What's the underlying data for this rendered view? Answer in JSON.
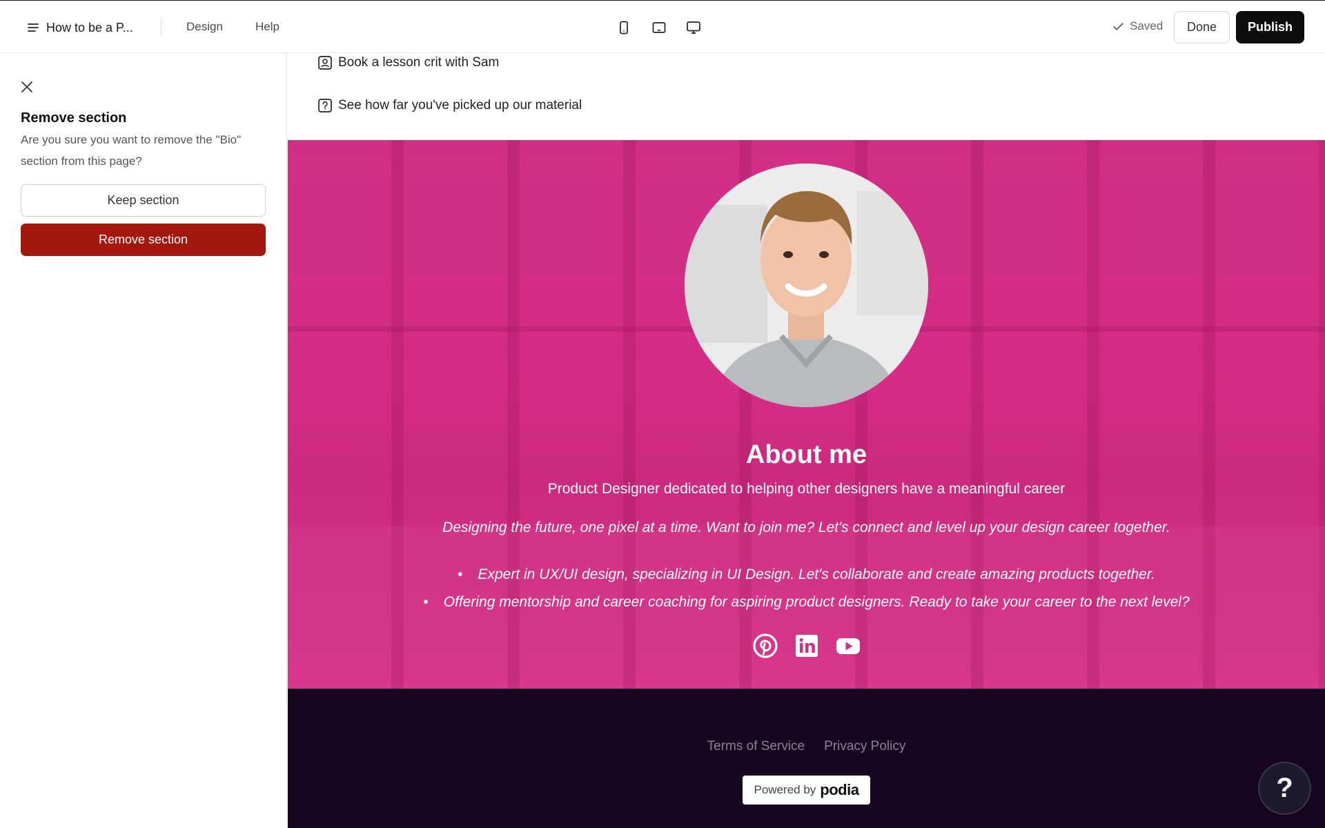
{
  "topbar": {
    "site_title": "How to be a P...",
    "nav": {
      "design": "Design",
      "help": "Help"
    },
    "devices": {
      "mobile": "phone-icon",
      "tablet": "tablet-icon",
      "desktop": "desktop-icon"
    },
    "saved_label": "Saved",
    "done_label": "Done",
    "publish_label": "Publish"
  },
  "sidebar": {
    "title": "Remove section",
    "description": "Are you sure you want to remove the \"Bio\" section from this page?",
    "keep_label": "Keep section",
    "remove_label": "Remove section",
    "remove_color": "#a3170f"
  },
  "links": [
    {
      "icon": "user-square-icon",
      "label": "Book a lesson crit with Sam"
    },
    {
      "icon": "question-square-icon",
      "label": "See how far you've picked up our material"
    }
  ],
  "bio": {
    "background_color": "#d52c86",
    "title": "About me",
    "subtitle": "Product Designer dedicated to helping other designers have a meaningful career",
    "tagline": "Designing the future, one pixel at a time. Want to join me? Let's connect and level up your design career together.",
    "bullets": [
      "Expert in UX/UI design, specializing in UI Design. Let's collaborate and create amazing products together.",
      "Offering mentorship and career coaching for aspiring product designers. Ready to take your career to the next level?"
    ],
    "social": [
      "pinterest-icon",
      "linkedin-icon",
      "youtube-icon"
    ]
  },
  "footer": {
    "background_color": "#190621",
    "terms": "Terms of Service",
    "privacy": "Privacy Policy",
    "powered_by": "Powered by",
    "brand": "podia"
  },
  "help_fab": "?"
}
